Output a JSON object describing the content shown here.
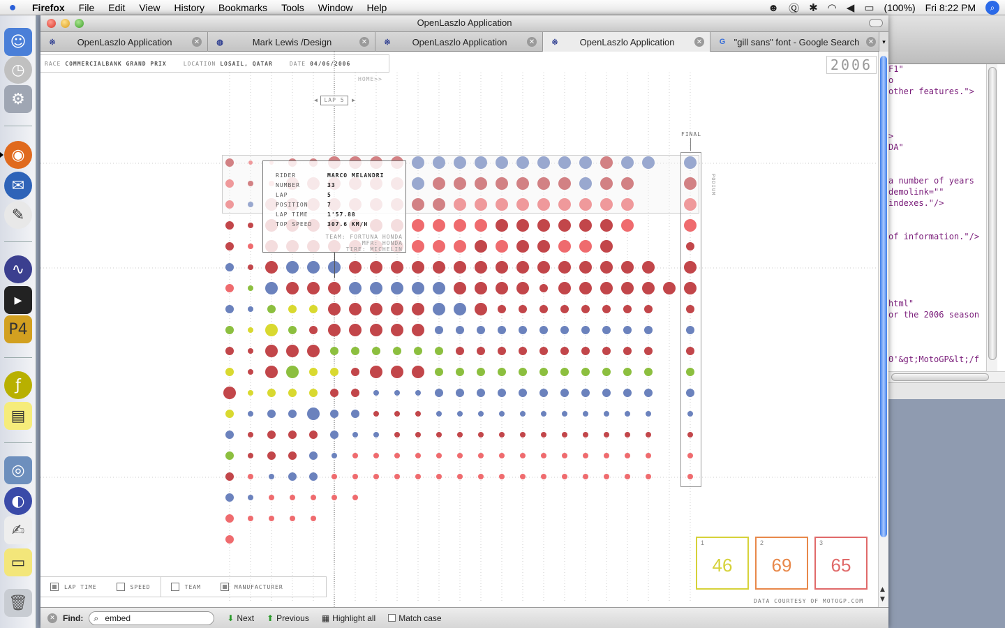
{
  "menubar": {
    "app_name": "Firefox",
    "items": [
      "File",
      "Edit",
      "View",
      "History",
      "Bookmarks",
      "Tools",
      "Window",
      "Help"
    ],
    "battery": "(100%)",
    "clock": "Fri 8:22 PM"
  },
  "window": {
    "title": "OpenLaszlo Application"
  },
  "tabs": [
    {
      "label": "OpenLaszlo Application",
      "icon": "openlaszlo-icon",
      "active": false
    },
    {
      "label": "Mark Lewis /Design",
      "icon": "globe-icon",
      "active": false
    },
    {
      "label": "OpenLaszlo Application",
      "icon": "openlaszlo-icon",
      "active": false
    },
    {
      "label": "OpenLaszlo Application",
      "icon": "openlaszlo-icon",
      "active": true
    },
    {
      "label": "\"gill sans\" font - Google Search",
      "icon": "google-icon",
      "active": false
    }
  ],
  "race": {
    "race_label": "RACE",
    "race_value": "COMMERCIALBANK GRAND PRIX",
    "location_label": "LOCATION",
    "location_value": "LOSAIL, QATAR",
    "date_label": "DATE",
    "date_value": "04/06/2006",
    "year": "2006",
    "home_link": "HOME>>",
    "lap_selector": "LAP 5",
    "final_label": "FINAL",
    "podium_label": "PODIUM"
  },
  "tooltip": {
    "rider_label": "RIDER",
    "rider": "MARCO MELANDRI",
    "number_label": "NUMBER",
    "number": "33",
    "lap_label": "LAP",
    "lap": "5",
    "position_label": "POSITION",
    "position": "7",
    "lap_time_label": "LAP TIME",
    "lap_time": "1'57.88",
    "top_speed_label": "TOP SPEED",
    "top_speed": "307.6 KM/H",
    "team": "TEAM: FORTUNA HONDA",
    "mfr": "MFR: HONDA",
    "tire": "TIRE: MICHELIN"
  },
  "filters": [
    {
      "label": "LAP TIME",
      "checked": true
    },
    {
      "label": "SPEED",
      "checked": false
    },
    {
      "label": "TEAM",
      "checked": false
    },
    {
      "label": "MANUFACTURER",
      "checked": true
    }
  ],
  "podium": [
    {
      "rank": "1",
      "number": "46",
      "color": "#d6d23a"
    },
    {
      "rank": "2",
      "number": "69",
      "color": "#e8884a"
    },
    {
      "rank": "3",
      "number": "65",
      "color": "#e06a6a"
    }
  ],
  "credits": "DATA COURTESY OF MOTOGP.COM",
  "colors": {
    "darkred": "#c2464a",
    "salmon": "#ef6b6e",
    "blue": "#6b82bd",
    "green": "#8cbf3f",
    "yellow": "#d9d930"
  },
  "dot_columns": 23,
  "dot_rows": [
    {
      "colors": "RssRRRRRRBBBBBBBBBRBBB",
      "sizes": "22222333333333333333333"
    },
    {
      "colors": "SRSRRRRRRBRRRRRRRBRRR",
      "sizes": "2113333333333333333333"
    },
    {
      "colors": "SBRRRRRRRRRSSSSSSSSSS",
      "sizes": "2133333333333333333333"
    },
    {
      "colors": "RRRRRRRRRSSSSRRRRRRSS",
      "sizes": "21333333333333333333333"
    },
    {
      "colors": "RSRRRRRRRSSSRSRRSSRR",
      "sizes": "213333333333333333322"
    },
    {
      "colors": "BRRBBBRRRRRRRRRRRRRRRR",
      "sizes": "21333333333333333333333"
    },
    {
      "colors": "SGBRRRBBBBBRRRRRRRRRRRR",
      "sizes": "21333333333333323333333"
    },
    {
      "colors": "BBGYYRRRRRBBRRRRRRRRRR",
      "sizes": "21222333333332222222221"
    },
    {
      "colors": "GYYGRRRRRRBBBBBBBBBBBB",
      "sizes": "21322333332222222222222"
    },
    {
      "colors": "RRRRRGGGGGGRRRRRRRRRRR",
      "sizes": "21333222222222222222222"
    },
    {
      "colors": "YRRGYYRRRRGGGGGGGGGGGG",
      "sizes": "21332223332222222222223"
    },
    {
      "colors": "RYYYYRRBBBBBBBBBBBBBBB",
      "sizes": "31222221112222222222221"
    },
    {
      "colors": "YBBBBBBRRRBBBBBBBBBBBB",
      "sizes": "21223221111111111111111"
    },
    {
      "colors": "BRRRRBBBRRRRRRRRRRRRRR",
      "sizes": "21222211111111111111111"
    },
    {
      "colors": "GRRRBBSSSSSSSSSSSSSSSS",
      "sizes": "21222111111111111111111"
    },
    {
      "colors": "RSBBBSSSSSSSSSSSSSSSSS",
      "sizes": "21122111111111111111111"
    },
    {
      "colors": "BBSSSSS",
      "sizes": "2111111"
    },
    {
      "colors": "SSSSS",
      "sizes": "21111"
    },
    {
      "colors": "S",
      "sizes": "2"
    }
  ],
  "findbar": {
    "label": "Find:",
    "value": "embed",
    "next": "Next",
    "previous": "Previous",
    "highlight": "Highlight all",
    "match_case": "Match case"
  },
  "background_code": [
    "F1\"",
    "o",
    " other features.\">",
    "",
    "",
    "",
    ">",
    "DA\"",
    "",
    "",
    " a number of years",
    " demolink=\"\"",
    " indexes.\"/>",
    "",
    "",
    "of information.\"/>",
    "",
    "",
    "",
    "",
    "",
    "html\"",
    "or the 2006 season",
    "",
    "",
    "",
    "0'&gt;MotoGP&lt;/f"
  ]
}
